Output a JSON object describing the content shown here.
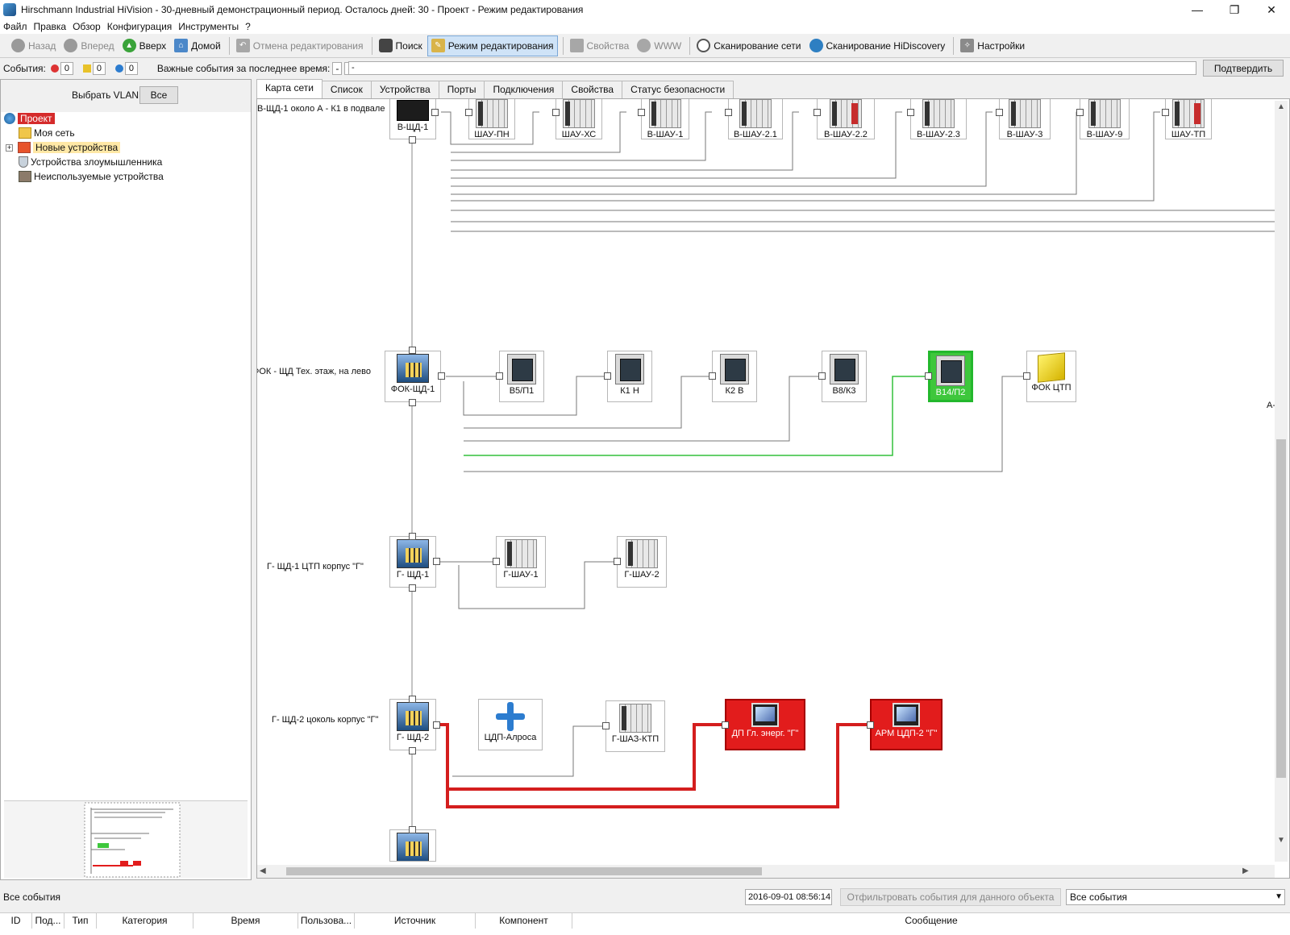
{
  "window": {
    "title": "Hirschmann Industrial HiVision - 30-дневный демонстрационный период. Осталось дней: 30 - Проект - Режим редактирования",
    "minimize": "—",
    "restore": "❐",
    "close": "✕"
  },
  "menu": [
    "Файл",
    "Правка",
    "Обзор",
    "Конфигурация",
    "Инструменты",
    "?"
  ],
  "toolbar": {
    "back": "Назад",
    "forward": "Вперед",
    "up": "Вверх",
    "home": "Домой",
    "undo_edit": "Отмена редактирования",
    "search": "Поиск",
    "edit_mode": "Режим редактирования",
    "properties": "Свойства",
    "www": "WWW",
    "scan_network": "Сканирование сети",
    "scan_hidiscovery": "Сканирование HiDiscovery",
    "settings": "Настройки"
  },
  "events_bar": {
    "label": "События:",
    "errors": "0",
    "warnings": "0",
    "info": "0",
    "important_label": "Важные события за последнее время:",
    "dash1": "-",
    "dash2": "-",
    "dash3": "-",
    "confirm": "Подтвердить"
  },
  "left_panel": {
    "vlan_label": "Выбрать VLAN:",
    "vlan_value": "Все",
    "tree": {
      "project": "Проект",
      "my_network": "Моя сеть",
      "new_devices": "Новые устройства",
      "intruder_devices": "Устройства злоумышленника",
      "unused_devices": "Неиспользуемые устройства"
    }
  },
  "tabs": [
    "Карта сети",
    "Список",
    "Устройства",
    "Порты",
    "Подключения",
    "Свойства",
    "Статус безопасности"
  ],
  "map": {
    "row1_label": "В-ЩД-1 около А - К1 в подвале",
    "row2_label": "ФОК - ЩД Тех. этаж, на лево",
    "row3_label": "Г- ЩД-1 ЦТП корпус \"Г\"",
    "row4_label": "Г- ЩД-2 цоколь корпус \"Г\"",
    "right_label": "А-Щ",
    "row1": [
      "В-ЩД-1",
      "ШАУ-ПН",
      "ШАУ-ХС",
      "В-ШАУ-1",
      "В-ШАУ-2.1",
      "В-ШАУ-2.2",
      "В-ШАУ-2.3",
      "В-ШАУ-3",
      "В-ШАУ-9",
      "ШАУ-ТП"
    ],
    "row2": [
      "ФОК-ЩД-1",
      "В5/П1",
      "К1 Н",
      "К2 В",
      "В8/К3",
      "В14/П2",
      "ФОК ЦТП"
    ],
    "row3": [
      "Г- ЩД-1",
      "Г-ШАУ-1",
      "Г-ШАУ-2"
    ],
    "row4": [
      "Г- ЩД-2",
      "ЦДП-Алроса",
      "Г-ШАЗ-КТП",
      "ДП Гл. энерг. \"Г\"",
      "АРМ ЦДП-2 \"Г\""
    ]
  },
  "bottom": {
    "all_events": "Все события",
    "timestamp": "2016-09-01 08:56:14",
    "filter": "Отфильтровать события для данного объекта",
    "select": "Все события"
  },
  "table": {
    "headers": [
      "ID",
      "Под...",
      "Тип",
      "Категория",
      "Время",
      "Пользова...",
      "Источник",
      "Компонент",
      "Сообщение"
    ]
  }
}
